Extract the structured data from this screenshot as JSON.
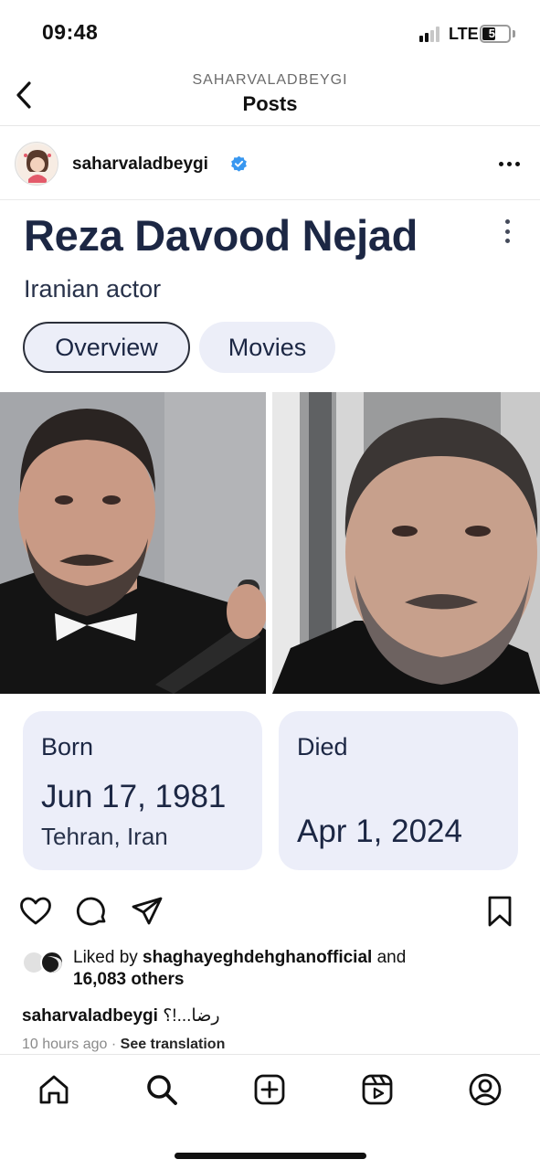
{
  "status_bar": {
    "time": "09:48",
    "network": "LTE",
    "battery": "51",
    "battery_level": 0.51,
    "signal_bars_active": 2,
    "signal_bars_total": 4
  },
  "header": {
    "username_caps": "SAHARVALADBEYGI",
    "title": "Posts",
    "back_icon": "chevron-left-icon"
  },
  "author": {
    "username": "saharvaladbeygi",
    "verified": true,
    "verified_color": "#3897f0",
    "more_icon": "more-horizontal-icon"
  },
  "post": {
    "person_name": "Reza Davood Nejad",
    "description": "Iranian actor",
    "tabs": [
      {
        "label": "Overview",
        "selected": true
      },
      {
        "label": "Movies",
        "selected": false
      }
    ],
    "born": {
      "label": "Born",
      "date": "Jun 17, 1981",
      "place": "Tehran, Iran"
    },
    "died": {
      "label": "Died",
      "date": "Apr 1, 2024"
    }
  },
  "actions": {
    "like_icon": "heart-icon",
    "comment_icon": "comment-icon",
    "share_icon": "send-icon",
    "save_icon": "bookmark-icon"
  },
  "likes": {
    "prefix": "Liked by ",
    "user": "shaghayeghdehghanofficial",
    "and": " and",
    "others": "16,083 others"
  },
  "caption": {
    "username": "saharvaladbeygi",
    "text": "رضا...!؟"
  },
  "meta": {
    "time": "10 hours ago",
    "separator": "·",
    "translation": "See translation"
  },
  "tab_bar": {
    "items": [
      "home-icon",
      "search-icon",
      "create-icon",
      "reels-icon",
      "profile-icon"
    ]
  },
  "colors": {
    "accent_text": "#1c2744",
    "card_bg": "#eceef9",
    "verified": "#3897f0"
  }
}
